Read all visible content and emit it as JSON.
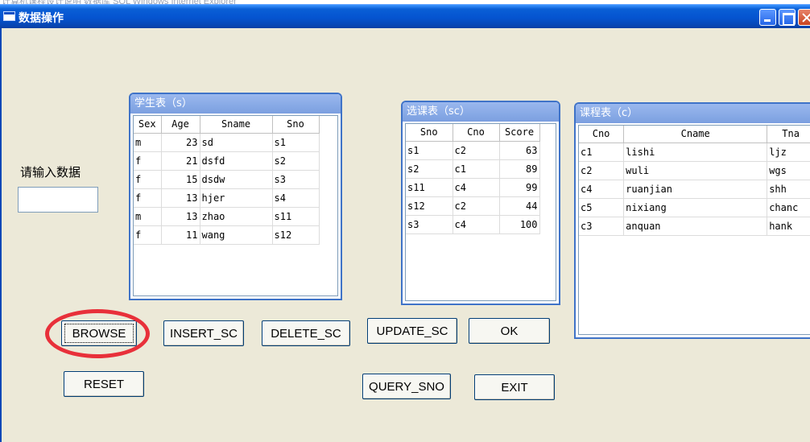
{
  "window": {
    "title": "数据操作",
    "background_title": "计算机课程设计说明 数据库 SQL Windows Internet Explorer"
  },
  "input_label": "请输入数据",
  "input_value": "",
  "panels": {
    "student": {
      "title": "学生表（s）",
      "columns": [
        "Sex",
        "Age",
        "Sname",
        "Sno"
      ],
      "rows": [
        [
          "m",
          "23",
          "sd",
          "s1"
        ],
        [
          "f",
          "21",
          "dsfd",
          "s2"
        ],
        [
          "f",
          "15",
          "dsdw",
          "s3"
        ],
        [
          "f",
          "13",
          "hjer",
          "s4"
        ],
        [
          "m",
          "13",
          "zhao",
          "s11"
        ],
        [
          "f",
          "11",
          "wang",
          "s12"
        ]
      ]
    },
    "sc": {
      "title": "选课表（sc）",
      "columns": [
        "Sno",
        "Cno",
        "Score"
      ],
      "rows": [
        [
          "s1",
          "c2",
          "63"
        ],
        [
          "s2",
          "c1",
          "89"
        ],
        [
          "s11",
          "c4",
          "99"
        ],
        [
          "s12",
          "c2",
          "44"
        ],
        [
          "s3",
          "c4",
          "100"
        ]
      ]
    },
    "course": {
      "title": "课程表（c）",
      "columns": [
        "Cno",
        "Cname",
        "Tna"
      ],
      "rows": [
        [
          "c1",
          "lishi",
          "ljz"
        ],
        [
          "c2",
          "wuli",
          "wgs"
        ],
        [
          "c4",
          "ruanjian",
          "shh"
        ],
        [
          "c5",
          "nixiang",
          "chanc"
        ],
        [
          "c3",
          "anquan",
          "hank"
        ]
      ]
    }
  },
  "buttons": {
    "browse": "BROWSE",
    "insert_sc": "INSERT_SC",
    "delete_sc": "DELETE_SC",
    "update_sc": "UPDATE_SC",
    "ok": "OK",
    "reset": "RESET",
    "query_sno": "QUERY_SNO",
    "exit": "EXIT"
  },
  "colors": {
    "annotation_circle": "#e8303a",
    "titlebar": "#0554d0",
    "panel_title": "#7b9fe0",
    "window_bg": "#ECE9D8"
  }
}
